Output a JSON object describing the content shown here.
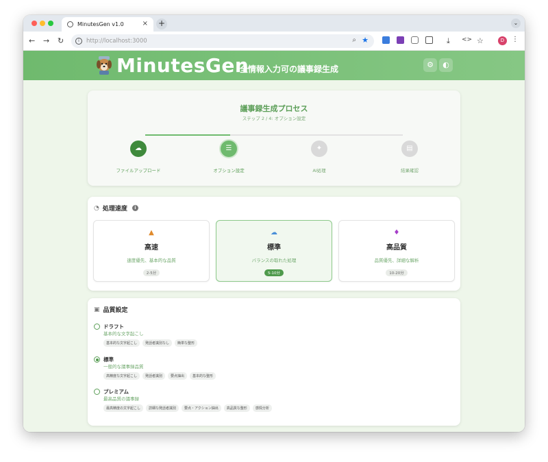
{
  "browser": {
    "tab_title": "MinutesGen v1.0",
    "tab_close": "×",
    "new_tab": "+",
    "url_host": "http://localhost",
    "url_port": ":3000",
    "avatar_letter": "D"
  },
  "header": {
    "brand": "MinutesGen",
    "tagline": "全情報入力可の議事録生成"
  },
  "process": {
    "title": "議事録生成プロセス",
    "subtitle": "ステップ 2 / 4: オプション設定",
    "progress_fraction": 0.33,
    "steps": [
      {
        "label": "ファイルアップロード",
        "state": "done",
        "icon": "cloud-upload-icon"
      },
      {
        "label": "オプション設定",
        "state": "active",
        "icon": "sliders-icon"
      },
      {
        "label": "AI処理",
        "state": "todo",
        "icon": "sparkle-icon"
      },
      {
        "label": "結果確認",
        "state": "todo",
        "icon": "document-icon"
      }
    ]
  },
  "speed": {
    "title": "処理速度",
    "options": [
      {
        "name": "高速",
        "desc": "速度優先、基本的な品質",
        "badge": "2-5分",
        "icon": "rocket-icon",
        "selected": false
      },
      {
        "name": "標準",
        "desc": "バランスの取れた処理",
        "badge": "5-10分",
        "icon": "cloud-icon",
        "selected": true
      },
      {
        "name": "高品質",
        "desc": "品質優先、詳細な解析",
        "badge": "10-20分",
        "icon": "gem-icon",
        "selected": false
      }
    ]
  },
  "quality": {
    "title": "品質設定",
    "options": [
      {
        "name": "ドラフト",
        "desc": "基本的な文字起こし",
        "selected": false,
        "features": [
          "基本的な文字起こし",
          "発話者識別なし",
          "簡単な整形"
        ]
      },
      {
        "name": "標準",
        "desc": "一般的な議事録品質",
        "selected": true,
        "features": [
          "高精度な文字起こし",
          "発話者識別",
          "要点抽出",
          "基本的な整形"
        ]
      },
      {
        "name": "プレミアム",
        "desc": "最高品質の議事録",
        "selected": false,
        "features": [
          "最高精度の文字起こし",
          "詳細な発話者識別",
          "要点・アクション抽出",
          "高品質な整形",
          "感情分析"
        ]
      }
    ]
  }
}
